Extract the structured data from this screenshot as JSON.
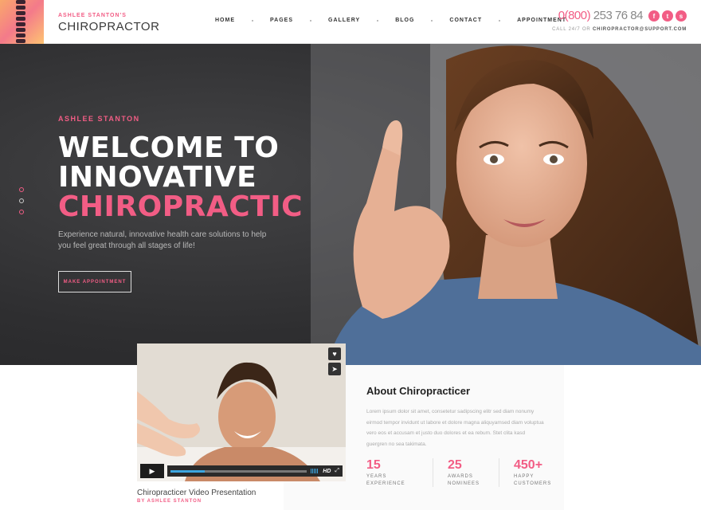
{
  "header": {
    "logo_sub": "ASHLEE STANTON'S",
    "logo_title": "CHIROPRACTOR",
    "nav": [
      "HOME",
      "PAGES",
      "GALLERY",
      "BLOG",
      "CONTACT",
      "APPOINTMENT"
    ],
    "phone_prefix": "0(800)",
    "phone_number": " 253 76 84",
    "socials": [
      "f",
      "t",
      "s"
    ],
    "contact_prefix": "CALL 24/7 OR",
    "contact_email": "CHIROPRACTOR@SUPPORT.COM"
  },
  "hero": {
    "kicker": "ASHLEE STANTON",
    "title_line1": "WELCOME TO",
    "title_line2": "INNOVATIVE",
    "title_line3": "CHIROPRACTIC",
    "description": "Experience natural, innovative health care solutions to help you feel great through all stages of life!",
    "button_label": "MAKE APPOINTMENT",
    "slide_count": 3,
    "active_slide": 3
  },
  "video": {
    "caption": "Chiropracticer Video Presentation",
    "by": "BY ASHLEE STANTON",
    "hd_label": "HD",
    "progress": 0.25
  },
  "about": {
    "title": "About Chiropracticer",
    "text": "Lorem ipsum dolor sit amet, consetetur sadipscing elitr sed diam nonumy eirmod tempor invidunt ut labore et dolore magna aliquyamsed diam voluptua vero eos et accusam et justo duo dolores et ea rebum. Stet clita kasd guergren no sea takimata.",
    "stats": [
      {
        "num": "15",
        "line1": "YEARS",
        "line2": "EXPERIENCE"
      },
      {
        "num": "25",
        "line1": "AWARDS",
        "line2": "NOMINEES"
      },
      {
        "num": "450+",
        "line1": "HAPPY",
        "line2": "CUSTOMERS"
      }
    ]
  },
  "colors": {
    "accent": "#f25d85",
    "hero_bg": "#2e2e30"
  }
}
